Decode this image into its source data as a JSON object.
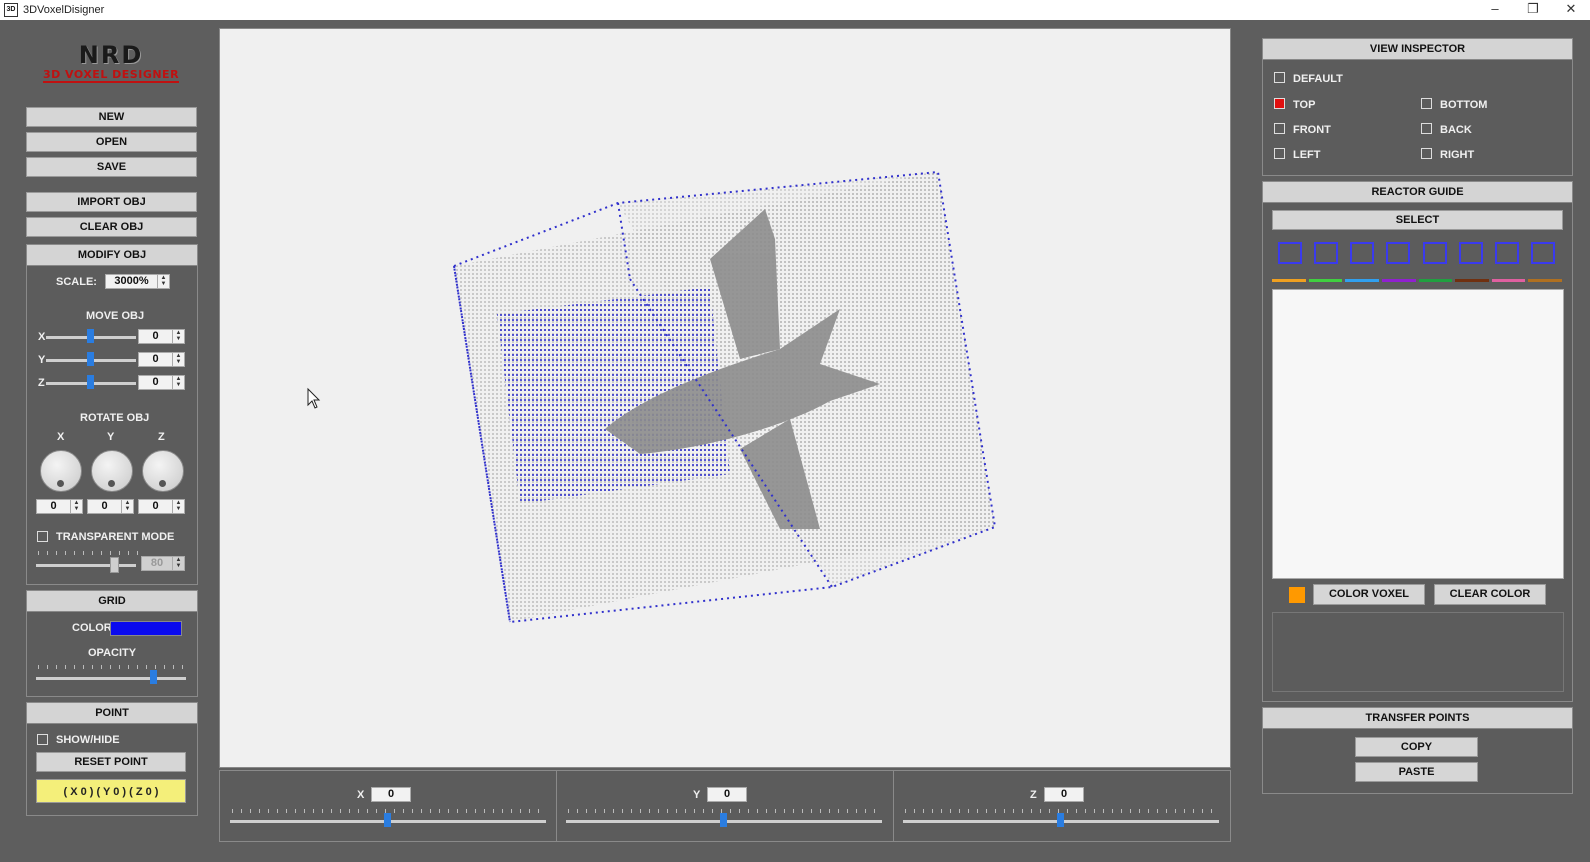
{
  "window": {
    "icon": "3D",
    "title": "3DVoxelDisigner",
    "minimize": "–",
    "maximize": "❐",
    "close": "✕"
  },
  "logo": {
    "top": "NRD",
    "bottom": "3D VOXEL DESIGNER"
  },
  "left": {
    "file_buttons": [
      "NEW",
      "OPEN",
      "SAVE"
    ],
    "obj_buttons": [
      "IMPORT OBJ",
      "CLEAR OBJ"
    ],
    "modify": {
      "header": "MODIFY OBJ",
      "scale_label": "SCALE:",
      "scale_value": "3000%",
      "move_label": "MOVE OBJ",
      "move": [
        {
          "axis": "X",
          "value": "0"
        },
        {
          "axis": "Y",
          "value": "0"
        },
        {
          "axis": "Z",
          "value": "0"
        }
      ],
      "rotate_label": "ROTATE OBJ",
      "rotate_axes": [
        "X",
        "Y",
        "Z"
      ],
      "rotate_values": [
        "0",
        "0",
        "0"
      ],
      "transparent_label": "TRANSPARENT MODE",
      "transparent_value": "80"
    },
    "grid": {
      "header": "GRID",
      "color_label": "COLOR",
      "color": "#0a0aee",
      "opacity_label": "OPACITY"
    },
    "point": {
      "header": "POINT",
      "show_label": "SHOW/HIDE",
      "reset_label": "RESET POINT",
      "coords": "( X 0 ) ( Y 0 ) ( Z 0 )"
    }
  },
  "bottom": [
    {
      "axis": "X",
      "value": "0"
    },
    {
      "axis": "Y",
      "value": "0"
    },
    {
      "axis": "Z",
      "value": "0"
    }
  ],
  "right": {
    "view_inspector": {
      "header": "VIEW INSPECTOR",
      "default": "DEFAULT",
      "top": "TOP",
      "bottom": "BOTTOM",
      "front": "FRONT",
      "back": "BACK",
      "left": "LEFT",
      "right": "RIGHT",
      "selected": "TOP"
    },
    "reactor_guide": {
      "header": "REACTOR GUIDE",
      "select_label": "SELECT",
      "swatch_colors": [
        "#f0a020",
        "#40d040",
        "#30a0f0",
        "#9020d0",
        "#20a040",
        "#703010",
        "#e060a0",
        "#b07020"
      ],
      "color_voxel_label": "COLOR VOXEL",
      "clear_color_label": "CLEAR COLOR",
      "voxel_color": "#ff9900"
    },
    "transfer": {
      "header": "TRANSFER POINTS",
      "copy_label": "COPY",
      "paste_label": "PASTE"
    }
  }
}
